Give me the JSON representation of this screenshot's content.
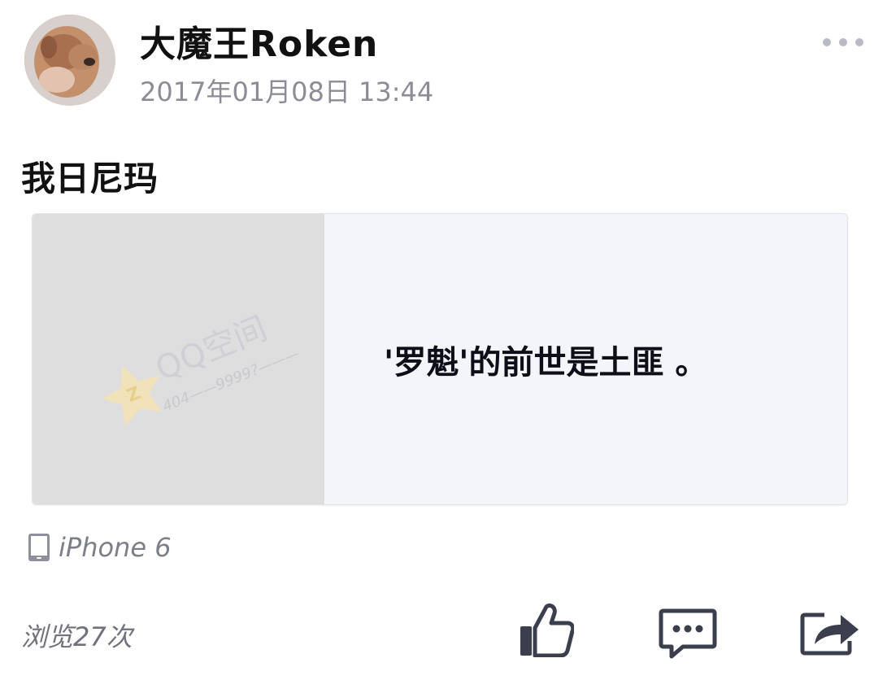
{
  "post": {
    "author": "大魔王Roken",
    "timestamp": "2017年01月08日 13:44",
    "text": "我日尼玛",
    "device": "iPhone 6",
    "views": "浏览27次"
  },
  "share_card": {
    "title": "'罗魁'的前世是土匪 。",
    "thumbnail_watermark": "QQ空间",
    "thumbnail_code": "404——9999?———"
  },
  "icons": {
    "more": "more-dots-icon",
    "device": "phone-icon",
    "like": "thumbs-up-icon",
    "comment": "comment-icon",
    "share": "share-icon"
  },
  "colors": {
    "icon_dark": "#3b3f4d",
    "meta_gray": "#8c8c96",
    "card_bg": "#f4f5f9",
    "thumb_bg": "#dedede"
  }
}
